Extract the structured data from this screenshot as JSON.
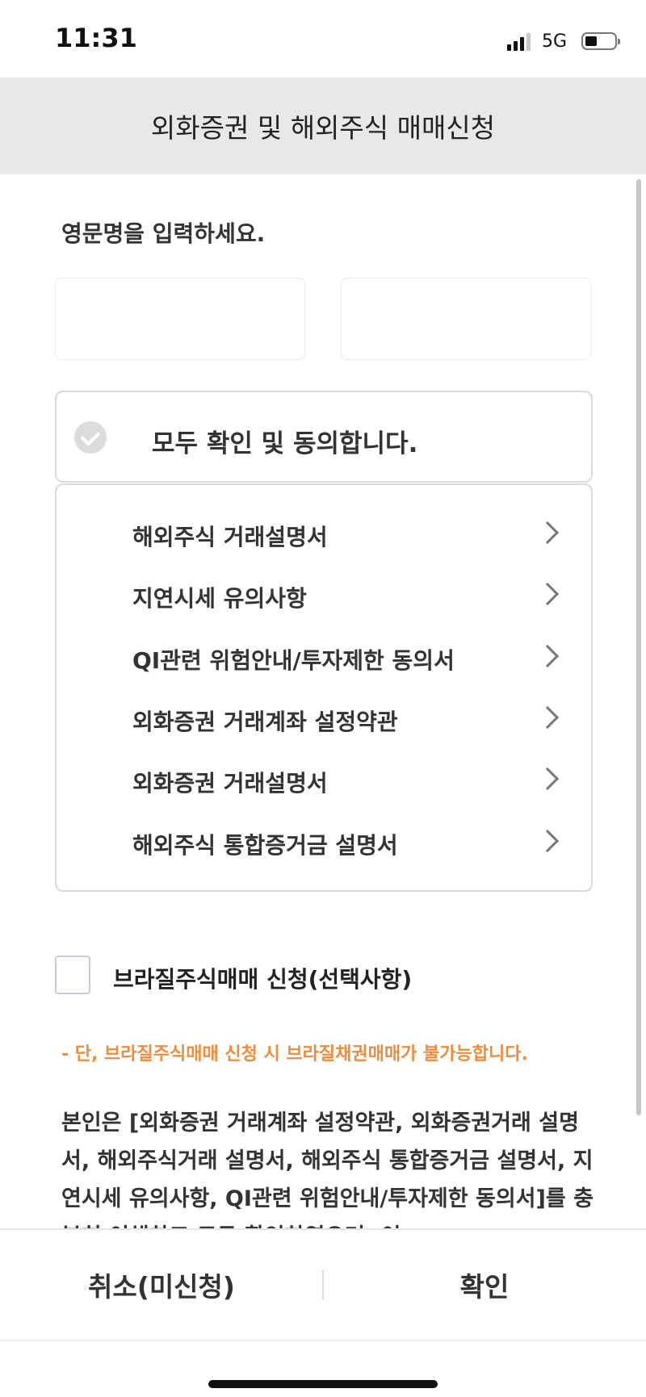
{
  "status": {
    "time": "11:31",
    "network": "5G"
  },
  "header": {
    "title": "외화증권 및 해외주식 매매신청"
  },
  "name_section": {
    "prompt": "영문명을 입력하세요.",
    "first_value": "",
    "last_value": ""
  },
  "agree_all": {
    "label": "모두 확인 및 동의합니다."
  },
  "terms": [
    {
      "label": "해외주식 거래설명서"
    },
    {
      "label": "지연시세 유의사항"
    },
    {
      "label": "QI관련 위험안내/투자제한 동의서"
    },
    {
      "label": "외화증권 거래계좌 설정약관"
    },
    {
      "label": "외화증권 거래설명서"
    },
    {
      "label": "해외주식 통합증거금 설명서"
    }
  ],
  "brazil": {
    "label": "브라질주식매매 신청(선택사항)",
    "note": "- 단, 브라질주식매매 신청 시 브라질채권매매가 불가능합니다."
  },
  "consent": {
    "text": "본인은 [외화증권 거래계좌 설정약관, 외화증권거래 설명서, 해외주식거래 설명서, 해외주식 통합증거금 설명서, 지연시세 유의사항, QI관련 위험안내/투자제한 동의서]를 충분히 이해하고 모두 확인하였으며, 이"
  },
  "footer": {
    "cancel_label": "취소(미신청)",
    "confirm_label": "확인"
  },
  "colors": {
    "nav_background": "#e8e8e8",
    "note_text": "#ef8b3c",
    "check_circle": "#dcdcdc"
  }
}
